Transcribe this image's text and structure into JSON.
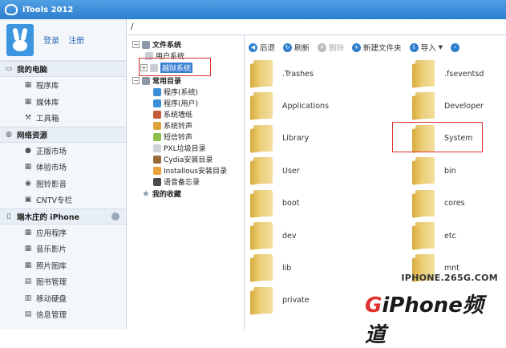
{
  "app": {
    "title": "iTools 2012"
  },
  "auth": {
    "login": "登录",
    "register": "注册"
  },
  "sidebar": {
    "sections": [
      {
        "title": "我的电脑",
        "items": [
          "程序库",
          "媒体库",
          "工具箱"
        ]
      },
      {
        "title": "网络资源",
        "items": [
          "正版市场",
          "体验市场",
          "图铃影音",
          "CNTV专栏"
        ]
      },
      {
        "title": "端木庄的 iPhone",
        "items": [
          "应用程序",
          "音乐影片",
          "照片图库",
          "图书管理",
          "移动硬盘",
          "信息管理"
        ]
      }
    ]
  },
  "path": {
    "current": "/"
  },
  "tree": {
    "root": "文件系统",
    "user_system": "用户系统",
    "jailbreak_system": "越狱系统",
    "common_dirs": "常用目录",
    "common_children": [
      "程序(系统)",
      "程序(用户)",
      "系统墙纸",
      "系统铃声",
      "短信铃声",
      "PXL垃圾目录",
      "Cydia安装目录",
      "Installous安装目录",
      "语音备忘录"
    ],
    "favorites": "我的收藏"
  },
  "toolbar": {
    "back": "后退",
    "refresh": "刷新",
    "delete": "删除",
    "new_folder": "新建文件夹",
    "import": "导入"
  },
  "files": {
    "left": [
      ".Trashes",
      "Applications",
      "Library",
      "User",
      "boot",
      "dev",
      "lib",
      "private"
    ],
    "right": [
      ".fseventsd",
      "Developer",
      "System",
      "bin",
      "cores",
      "etc",
      "mnt"
    ]
  },
  "watermark": {
    "url": "IPHONE.265G.COM",
    "logo_g": "G",
    "logo_rest": "iPhone频道"
  }
}
